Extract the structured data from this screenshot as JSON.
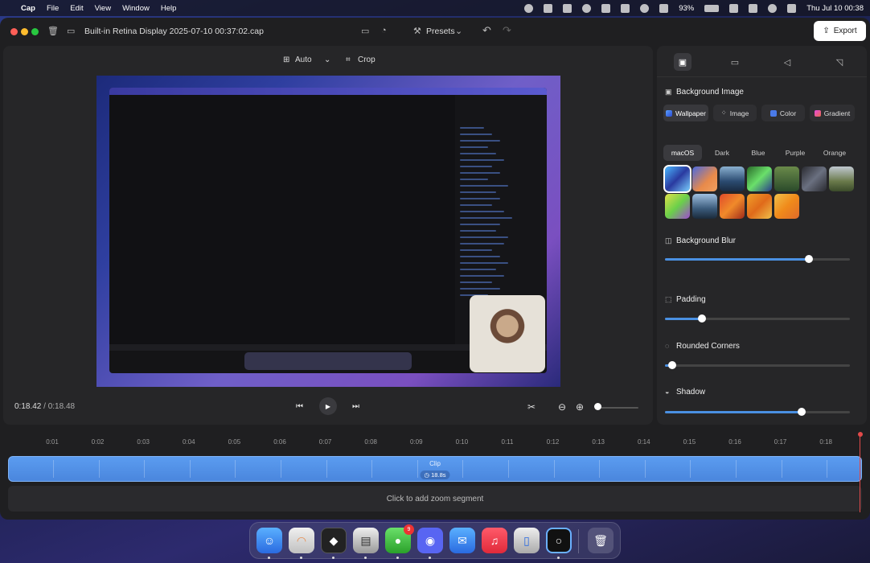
{
  "menubar": {
    "app_name": "Cap",
    "items": [
      "File",
      "Edit",
      "View",
      "Window",
      "Help"
    ],
    "battery": "93%",
    "clock": "Thu Jul 10  00:38"
  },
  "titlebar": {
    "file_title": "Built-in Retina Display 2025-07-10 00:37:02.cap",
    "presets_label": "Presets",
    "export_label": "Export"
  },
  "preview": {
    "aspect_label": "Auto",
    "crop_label": "Crop",
    "time_current": "0:18.42",
    "time_separator": " / ",
    "time_total": "0:18.48",
    "zoom_level": 0
  },
  "sidepanel": {
    "background_image_title": "Background Image",
    "bg_types": [
      "Wallpaper",
      "Image",
      "Color",
      "Gradient"
    ],
    "themes": [
      "macOS",
      "Dark",
      "Blue",
      "Purple",
      "Orange"
    ],
    "blur_title": "Background Blur",
    "blur_value": 0.78,
    "padding_title": "Padding",
    "padding_value": 0.2,
    "corners_title": "Rounded Corners",
    "corners_value": 0.04,
    "shadow_title": "Shadow",
    "shadow_value": 0.74
  },
  "timeline": {
    "ticks": [
      "0:01",
      "0:02",
      "0:03",
      "0:04",
      "0:05",
      "0:06",
      "0:07",
      "0:08",
      "0:09",
      "0:10",
      "0:11",
      "0:12",
      "0:13",
      "0:14",
      "0:15",
      "0:16",
      "0:17",
      "0:18"
    ],
    "clip_label": "Clip",
    "clip_duration": "18.8s",
    "zoom_prompt": "Click to add zoom segment"
  },
  "dock": {
    "messages_badge": "9"
  }
}
